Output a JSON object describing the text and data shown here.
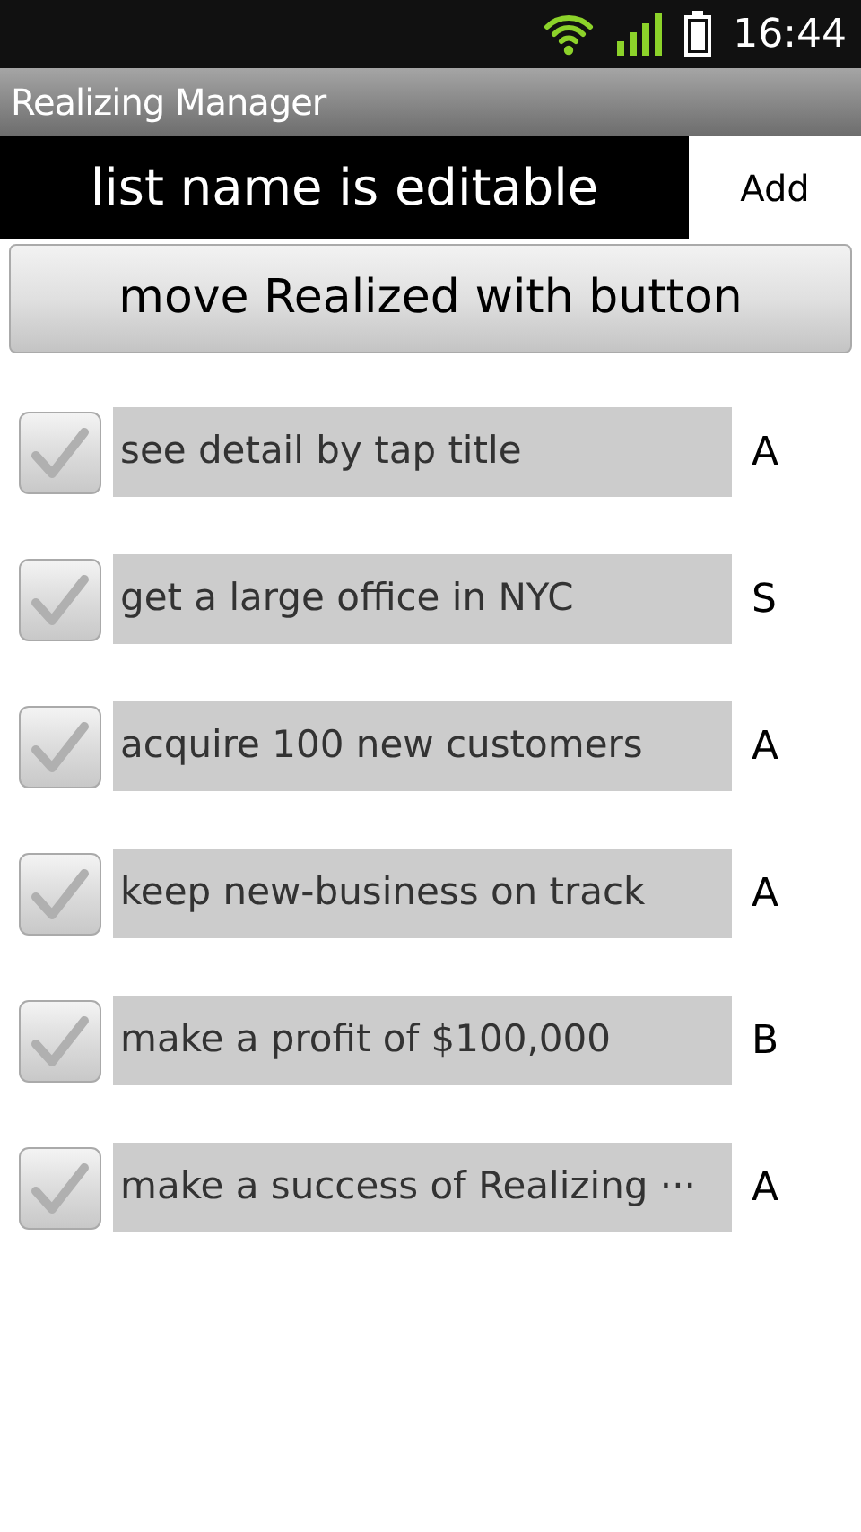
{
  "status_bar": {
    "time": "16:44"
  },
  "window": {
    "title": "Realizing Manager"
  },
  "list_name": {
    "value": "list name is editable"
  },
  "add_button": {
    "label": "Add"
  },
  "move_button": {
    "label": "move Realized with button"
  },
  "items": [
    {
      "title": "see detail by tap title",
      "grade": "A",
      "checked": false
    },
    {
      "title": "get a large office in NYC",
      "grade": "S",
      "checked": false
    },
    {
      "title": "acquire 100 new customers",
      "grade": "A",
      "checked": false
    },
    {
      "title": "keep new-business on track",
      "grade": "A",
      "checked": false
    },
    {
      "title": "make a profit of $100,000",
      "grade": "B",
      "checked": false
    },
    {
      "title": "make a success of Realizing ···",
      "grade": "A",
      "checked": false
    }
  ]
}
